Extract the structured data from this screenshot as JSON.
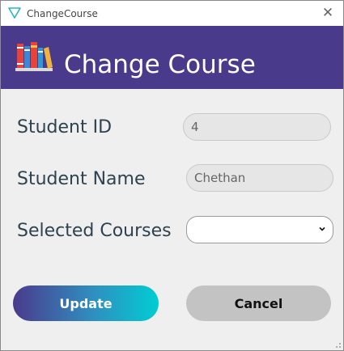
{
  "window": {
    "title": "ChangeCourse",
    "close_glyph": "✕"
  },
  "header": {
    "title": "Change Course",
    "icon": "books-icon",
    "background": "#4a3a8b"
  },
  "form": {
    "student_id": {
      "label": "Student ID",
      "value": "4"
    },
    "student_name": {
      "label": "Student Name",
      "value": "Chethan"
    },
    "selected_courses": {
      "label": "Selected Courses",
      "value": ""
    }
  },
  "buttons": {
    "update_label": "Update",
    "cancel_label": "Cancel"
  },
  "colors": {
    "accent": "#4a3a8b",
    "gradient_end": "#00cdd3",
    "label_text": "#2f4250"
  }
}
